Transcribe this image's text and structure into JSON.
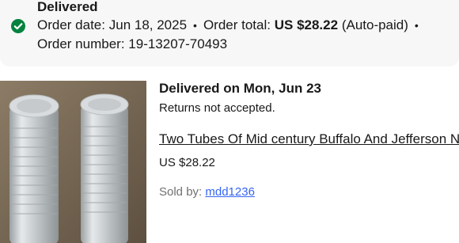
{
  "order": {
    "status": "Delivered",
    "order_date_label": "Order date:",
    "order_date": "Jun 18, 2025",
    "order_total_label": "Order total:",
    "order_total": "US $28.22",
    "payment_note": "(Auto-paid)",
    "separator": "•",
    "order_number_label": "Order number:",
    "order_number": "19-13207-70493",
    "status_icon": "check-circle-icon",
    "status_color": "#05823f"
  },
  "item": {
    "delivered_on": "Delivered on Mon, Jun 23",
    "returns_note": "Returns not accepted.",
    "title": "Two Tubes Of Mid century Buffalo And Jefferson N",
    "price": "US $28.22",
    "sold_by_label": "Sold by:",
    "seller": "mdd1236",
    "link_color": "#3665f3"
  }
}
